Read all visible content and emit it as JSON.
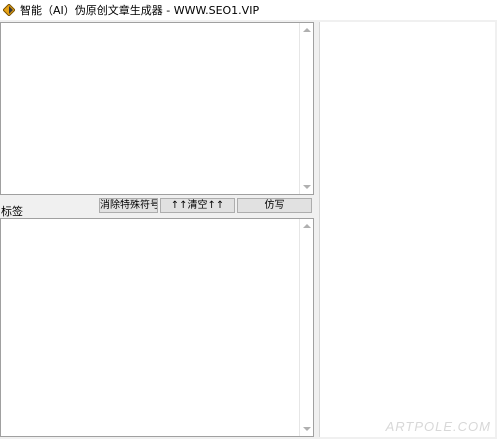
{
  "window": {
    "title": "智能（AI）伪原创文章生成器 - WWW.SEO1.VIP",
    "icon": "app-diamond-icon"
  },
  "input_area": {
    "value": ""
  },
  "output_area": {
    "value": ""
  },
  "toolbar": {
    "tag_label": "标签",
    "clear_special_label": "消除特殊符号",
    "clear_up_label": "↑↑清空↑↑",
    "rewrite_label": "仿写"
  },
  "watermark": {
    "text": "ARTPOLE.COM"
  },
  "colors": {
    "button_bg": "#e1e1e1",
    "window_bg": "#f0f0f0",
    "icon_fill": "#e8a317"
  }
}
